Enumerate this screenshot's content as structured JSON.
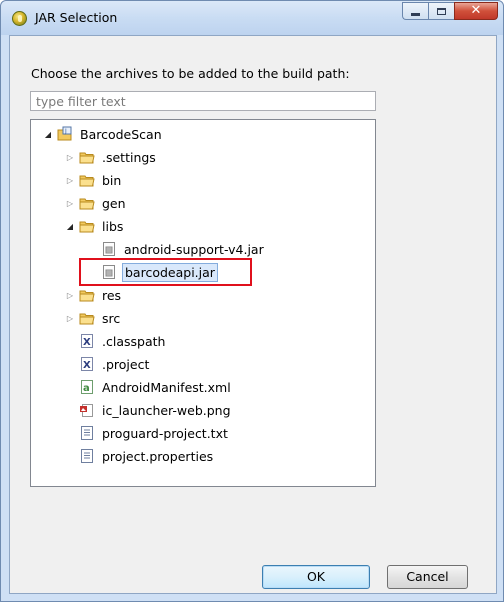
{
  "window": {
    "title": "JAR Selection",
    "controls": {
      "minimize": "minimize",
      "maximize": "maximize",
      "close": "✕"
    }
  },
  "dialog": {
    "instruction": "Choose the archives to be added to the build path:",
    "filter_placeholder": "type filter text"
  },
  "tree": [
    {
      "label": "BarcodeScan",
      "icon": "project-icon",
      "level": 0,
      "toggle": "expanded"
    },
    {
      "label": ".settings",
      "icon": "folder-icon",
      "level": 1,
      "toggle": "collapsed"
    },
    {
      "label": "bin",
      "icon": "folder-icon",
      "level": 1,
      "toggle": "collapsed"
    },
    {
      "label": "gen",
      "icon": "folder-icon",
      "level": 1,
      "toggle": "collapsed"
    },
    {
      "label": "libs",
      "icon": "folder-icon",
      "level": 1,
      "toggle": "expanded"
    },
    {
      "label": "android-support-v4.jar",
      "icon": "jar-icon",
      "level": 2,
      "toggle": "none"
    },
    {
      "label": "barcodeapi.jar",
      "icon": "jar-icon",
      "level": 2,
      "toggle": "none",
      "selected": true,
      "highlighted": true
    },
    {
      "label": "res",
      "icon": "folder-icon",
      "level": 1,
      "toggle": "collapsed"
    },
    {
      "label": "src",
      "icon": "folder-icon",
      "level": 1,
      "toggle": "collapsed"
    },
    {
      "label": ".classpath",
      "icon": "xml-file-icon",
      "level": 1,
      "toggle": "none"
    },
    {
      "label": ".project",
      "icon": "xml-file-icon",
      "level": 1,
      "toggle": "none"
    },
    {
      "label": "AndroidManifest.xml",
      "icon": "manifest-icon",
      "level": 1,
      "toggle": "none"
    },
    {
      "label": "ic_launcher-web.png",
      "icon": "image-file-icon",
      "level": 1,
      "toggle": "none"
    },
    {
      "label": "proguard-project.txt",
      "icon": "text-file-icon",
      "level": 1,
      "toggle": "none"
    },
    {
      "label": "project.properties",
      "icon": "text-file-icon",
      "level": 1,
      "toggle": "none"
    }
  ],
  "buttons": {
    "ok": "OK",
    "cancel": "Cancel"
  },
  "colors": {
    "selection": "#d9e8fb",
    "highlight_box": "#e0101c",
    "folder": "#f2c95e"
  }
}
